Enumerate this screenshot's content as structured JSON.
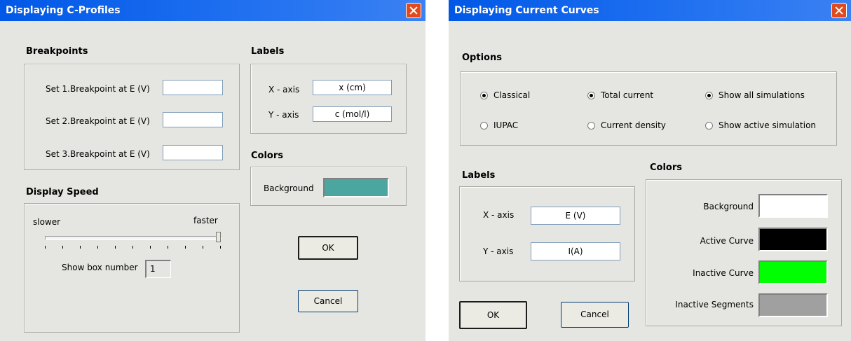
{
  "left_dialog": {
    "title": "Displaying C-Profiles",
    "breakpoints": {
      "title": "Breakpoints",
      "rows": [
        {
          "label": "Set 1.Breakpoint at E (V)",
          "value": ""
        },
        {
          "label": "Set 2.Breakpoint at E (V)",
          "value": ""
        },
        {
          "label": "Set 3.Breakpoint at E (V)",
          "value": ""
        }
      ]
    },
    "labels": {
      "title": "Labels",
      "x_label": "X - axis",
      "x_value": "x (cm)",
      "y_label": "Y - axis",
      "y_value": "c (mol/l)"
    },
    "colors": {
      "title": "Colors",
      "background_label": "Background",
      "background_color": "#4ca6a0"
    },
    "display_speed": {
      "title": "Display Speed",
      "slower": "slower",
      "faster": "faster",
      "slider_fraction": 1.0,
      "tick_count": 11,
      "box_label": "Show box number",
      "box_value": "1"
    },
    "ok_label": "OK",
    "cancel_label": "Cancel"
  },
  "right_dialog": {
    "title": "Displaying Current Curves",
    "options": {
      "title": "Options",
      "radios": [
        {
          "label": "Classical",
          "checked": true
        },
        {
          "label": "Total current",
          "checked": true
        },
        {
          "label": "Show all simulations",
          "checked": true
        },
        {
          "label": "IUPAC",
          "checked": false
        },
        {
          "label": "Current density",
          "checked": false
        },
        {
          "label": "Show active simulation",
          "checked": false
        }
      ]
    },
    "labels": {
      "title": "Labels",
      "x_label": "X - axis",
      "x_value": "E (V)",
      "y_label": "Y - axis",
      "y_value": "I(A)"
    },
    "colors": {
      "title": "Colors",
      "items": [
        {
          "label": "Background",
          "color": "#ffffff"
        },
        {
          "label": "Active Curve",
          "color": "#000000"
        },
        {
          "label": "Inactive Curve",
          "color": "#00ff00"
        },
        {
          "label": "Inactive Segments",
          "color": "#a0a0a0"
        }
      ]
    },
    "ok_label": "OK",
    "cancel_label": "Cancel"
  },
  "theme": {
    "title_bar": "#0058e6",
    "dialog_bg": "#e5e6e2",
    "close_button": "#e04a1f"
  }
}
